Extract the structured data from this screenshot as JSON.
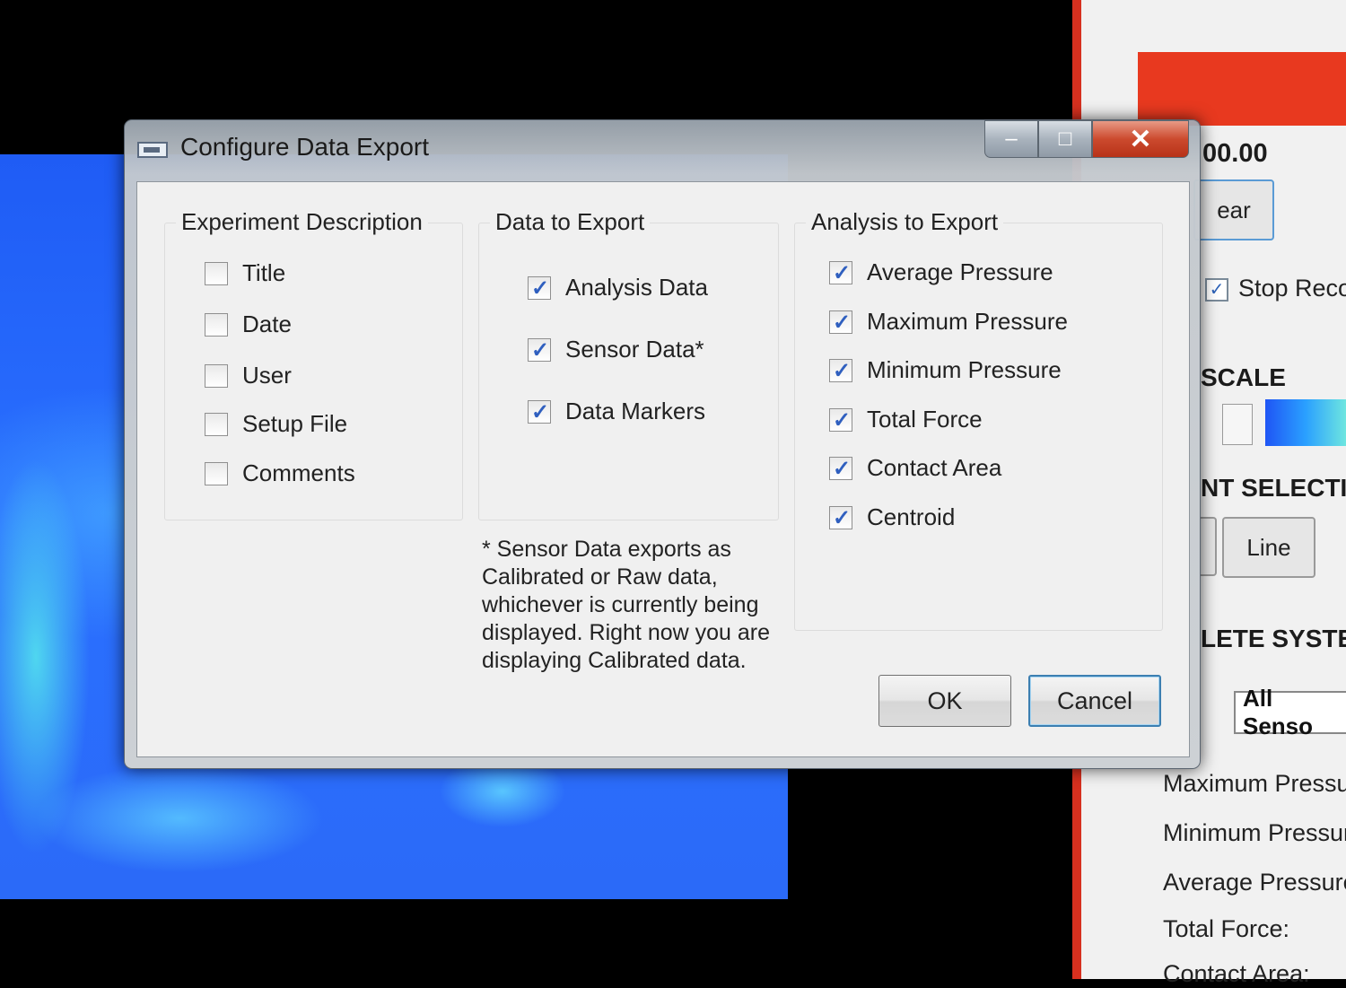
{
  "background_app": {
    "readout": "00.00",
    "clear_button": "ear",
    "stop_record_label": "Stop Recor",
    "scale_heading": "SCALE",
    "element_select_heading": "NT SELECTI",
    "line_button": "Line",
    "complete_system_heading": "LETE SYSTE",
    "sensor_select_value": "All Senso",
    "stats": {
      "max_pressure": "Maximum Pressure:",
      "min_pressure": "Minimum Pressure:",
      "avg_pressure": "Average Pressure:",
      "total_force": "Total Force:",
      "contact_area": "Contact Area:"
    },
    "colors": {
      "panel_red": "#e8391f",
      "heatmap_blue": "#2a6cff"
    }
  },
  "dialog": {
    "title": "Configure Data Export",
    "window_controls": {
      "minimize": "–",
      "maximize": "□",
      "close": "✕"
    },
    "experiment_description": {
      "label": "Experiment Description",
      "items": [
        {
          "label": "Title",
          "checked": false
        },
        {
          "label": "Date",
          "checked": false
        },
        {
          "label": "User",
          "checked": false
        },
        {
          "label": "Setup File",
          "checked": false
        },
        {
          "label": "Comments",
          "checked": false
        }
      ]
    },
    "data_to_export": {
      "label": "Data to Export",
      "items": [
        {
          "label": "Analysis Data",
          "checked": true
        },
        {
          "label": "Sensor Data*",
          "checked": true
        },
        {
          "label": "Data Markers",
          "checked": true
        }
      ]
    },
    "analysis_to_export": {
      "label": "Analysis to Export",
      "items": [
        {
          "label": "Average Pressure",
          "checked": true
        },
        {
          "label": "Maximum Pressure",
          "checked": true
        },
        {
          "label": "Minimum Pressure",
          "checked": true
        },
        {
          "label": "Total Force",
          "checked": true
        },
        {
          "label": "Contact Area",
          "checked": true
        },
        {
          "label": "Centroid",
          "checked": true
        }
      ]
    },
    "note": "* Sensor Data exports as Calibrated or Raw data, whichever is currently being displayed. Right now you are displaying Calibrated data.",
    "ok_label": "OK",
    "cancel_label": "Cancel"
  }
}
